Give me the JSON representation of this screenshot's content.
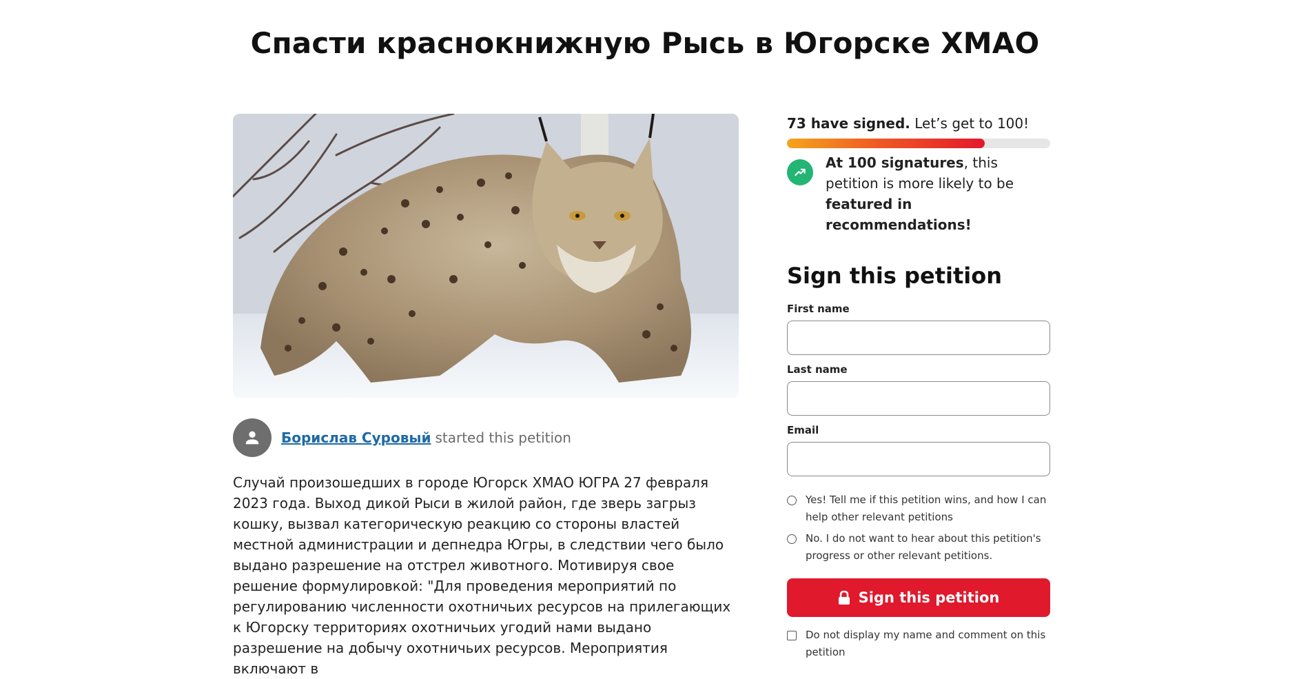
{
  "page": {
    "title": "Спасти краснокнижную Рысь в Югорске ХМАО"
  },
  "hero_image": {
    "icon": "lynx-photo"
  },
  "starter": {
    "name": "Борислав Суровый",
    "suffix": "started this petition",
    "avatar_icon": "user-icon"
  },
  "description": "Случай произошедших в городе Югорск ХМАО ЮГРА 27 февраля 2023 года. Выход дикой Рыси в жилой район, где зверь загрыз кошку, вызвал категорическую реакцию со стороны властей местной администрации и депнедра Югры, в следствии чего было выдано разрешение на отстрел животного. Мотивируя свое решение формулировкой: \"Для проведения мероприятий по регулированию численности охотничьих ресурсов на прилегающих к Югорску территориях охотничьих угодий нами выдано разрешение на добычу охотничьих ресурсов. Мероприятия включают в",
  "signatures": {
    "count_text": "73 have signed.",
    "goal_text": "Let’s get to 100!",
    "current": 73,
    "goal": 100,
    "progress_fraction": 0.75,
    "colors": {
      "start": "#f4a51c",
      "end": "#e3172b",
      "track": "#e6e6e6"
    }
  },
  "milestone": {
    "icon": "trending-up-icon",
    "bold_1": "At 100 signatures",
    "text_1": ", this petition is more likely to be ",
    "bold_2": "featured in recommendations!"
  },
  "form": {
    "heading": "Sign this petition",
    "first_name_label": "First name",
    "first_name_value": "",
    "last_name_label": "Last name",
    "last_name_value": "",
    "email_label": "Email",
    "email_value": "",
    "opt_in_yes": "Yes! Tell me if this petition wins, and how I can help other relevant petitions",
    "opt_in_no": "No. I do not want to hear about this petition's progress or other relevant petitions.",
    "submit_label": "Sign this petition",
    "submit_icon": "lock-icon",
    "hide_name_label": "Do not display my name and comment on this petition"
  },
  "colors": {
    "accent": "#e0192d",
    "link": "#1f6aa5",
    "milestone_badge": "#22b573"
  }
}
